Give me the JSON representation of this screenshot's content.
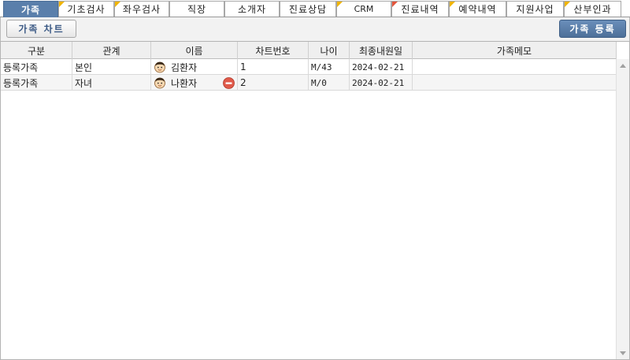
{
  "tabs": [
    {
      "label": "가족",
      "active": true,
      "flag": ""
    },
    {
      "label": "기초검사",
      "active": false,
      "flag": "yellow"
    },
    {
      "label": "좌우검사",
      "active": false,
      "flag": "yellow"
    },
    {
      "label": "직장",
      "active": false,
      "flag": ""
    },
    {
      "label": "소개자",
      "active": false,
      "flag": ""
    },
    {
      "label": "진료상담",
      "active": false,
      "flag": ""
    },
    {
      "label": "CRM",
      "active": false,
      "flag": "yellow"
    },
    {
      "label": "진료내역",
      "active": false,
      "flag": "red"
    },
    {
      "label": "예약내역",
      "active": false,
      "flag": "yellow"
    },
    {
      "label": "지원사업",
      "active": false,
      "flag": ""
    },
    {
      "label": "산부인과",
      "active": false,
      "flag": "yellow"
    }
  ],
  "toolbar": {
    "family_chart_label": "가족 차트",
    "family_register_label": "가족 등록"
  },
  "grid": {
    "columns": [
      "구분",
      "관계",
      "이름",
      "차트번호",
      "나이",
      "최종내원일",
      "가족메모"
    ],
    "rows": [
      {
        "type": "등록가족",
        "relation": "본인",
        "name": "김환자",
        "chart_no": "1",
        "age": "M/43",
        "last_visit": "2024-02-21",
        "memo": "",
        "removable": false
      },
      {
        "type": "등록가족",
        "relation": "자녀",
        "name": "나환자",
        "chart_no": "2",
        "age": "M/0",
        "last_visit": "2024-02-21",
        "memo": "",
        "removable": true
      }
    ]
  },
  "colors": {
    "active_tab": "#5a7fab",
    "register_button": "#5a7fab",
    "flag_yellow": "#f0b400",
    "flag_red": "#e2553c",
    "remove_icon": "#e05a4a"
  }
}
